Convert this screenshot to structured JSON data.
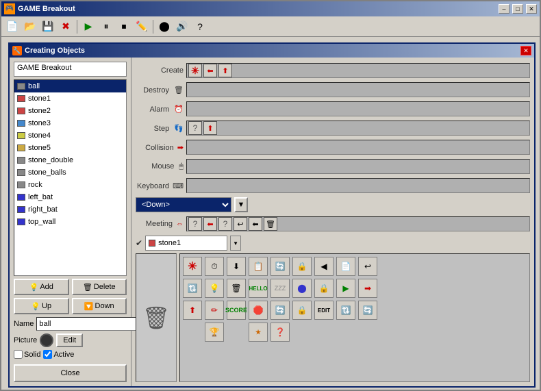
{
  "mainWindow": {
    "title": "GAME Breakout",
    "icon": "🎮"
  },
  "toolbar": {
    "buttons": [
      "📄",
      "📂",
      "💾",
      "❌",
      "▶",
      "⬛",
      "⬜",
      "✏️",
      "⚫",
      "🔊",
      "?"
    ]
  },
  "dialog": {
    "title": "Creating Objects",
    "icon": "🔧",
    "projectName": "GAME Breakout"
  },
  "objectList": {
    "items": [
      {
        "name": "ball",
        "color": "#888888",
        "selected": true
      },
      {
        "name": "stone1",
        "color": "#cc4444"
      },
      {
        "name": "stone2",
        "color": "#cc4444"
      },
      {
        "name": "stone3",
        "color": "#4488cc"
      },
      {
        "name": "stone4",
        "color": "#cccc44"
      },
      {
        "name": "stone5",
        "color": "#ccaa44"
      },
      {
        "name": "stone_double",
        "color": "#888888"
      },
      {
        "name": "stone_balls",
        "color": "#888888"
      },
      {
        "name": "rock",
        "color": "#888888"
      },
      {
        "name": "left_bat",
        "color": "#3333cc"
      },
      {
        "name": "right_bat",
        "color": "#3333cc"
      },
      {
        "name": "top_wall",
        "color": "#3333cc"
      }
    ]
  },
  "leftButtons": {
    "add": "Add",
    "delete": "Delete",
    "up": "Up",
    "down": "Down",
    "close": "Close"
  },
  "nameField": {
    "label": "Name",
    "value": "ball"
  },
  "pictureField": {
    "label": "Picture"
  },
  "editButton": "Edit",
  "checkboxes": {
    "solid": {
      "label": "Solid",
      "checked": false
    },
    "active": {
      "label": "Active",
      "checked": true
    }
  },
  "events": {
    "create": {
      "label": "Create"
    },
    "destroy": {
      "label": "Destroy"
    },
    "alarm": {
      "label": "Alarm"
    },
    "step": {
      "label": "Step"
    },
    "collision": {
      "label": "Collision"
    },
    "mouse": {
      "label": "Mouse"
    },
    "keyboard": {
      "label": "Keyboard"
    }
  },
  "dropdown": {
    "value": "<Down>"
  },
  "meeting": {
    "label": "Meeting"
  },
  "objectSelector": {
    "value": "stone1"
  },
  "windowButtons": {
    "minimize": "–",
    "maximize": "□",
    "close": "✕"
  },
  "actionGrid": {
    "row1": [
      "✳",
      "⏱",
      "⬇",
      "📋",
      "🔄",
      "🔒",
      "◀",
      "📄"
    ],
    "row2": [
      "↩",
      "🔄",
      "💡",
      "🗑",
      "HELLO",
      "💤",
      "⬤",
      "🔒"
    ],
    "row3": [
      "▶️",
      "➡",
      "⬆",
      "🖊",
      "📊",
      "🛑",
      "🔄",
      "🔒",
      "EDIT"
    ],
    "row4": [
      "🔃",
      "🔄",
      "🏆",
      "📊",
      "❓"
    ]
  }
}
